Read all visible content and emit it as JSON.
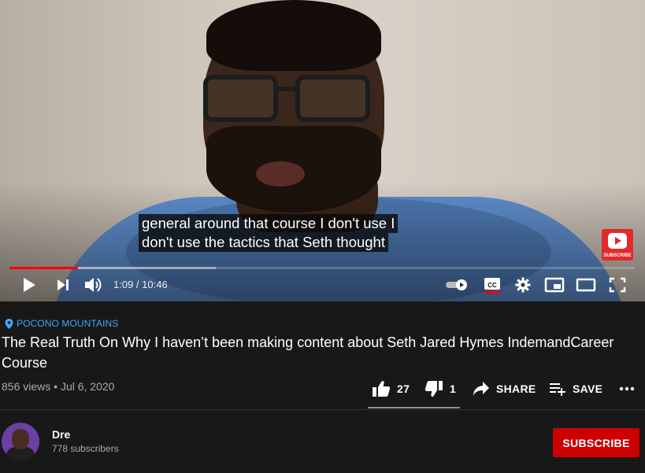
{
  "player": {
    "captions": [
      "general around that course I don't use I",
      "don't use the tactics that Seth thought"
    ],
    "watermark_label": "SUBSCRIBE",
    "progress_played_fraction": 0.11,
    "progress_buffered_fraction": 0.33,
    "time_display": "1:09 / 10:46",
    "icons": [
      "play-icon",
      "next-icon",
      "volume-icon",
      "autoplay-toggle-icon",
      "cc-icon",
      "settings-icon",
      "miniplayer-icon",
      "theater-icon",
      "fullscreen-icon"
    ],
    "accent_color": "#ff0000"
  },
  "video": {
    "location": "POCONO MOUNTAINS",
    "title": "The Real Truth On Why I haven’t been making content about Seth Jared Hymes IndemandCareer Course",
    "views": "856 views",
    "separator": "•",
    "date": "Jul 6, 2020"
  },
  "actions": {
    "likes": "27",
    "dislikes": "1",
    "share_label": "SHARE",
    "save_label": "SAVE",
    "more_icon": "more-icon"
  },
  "channel": {
    "name": "Dre",
    "subscribers": "778 subscribers",
    "subscribe_label": "SUBSCRIBE",
    "subscribe_color": "#cc0000"
  }
}
